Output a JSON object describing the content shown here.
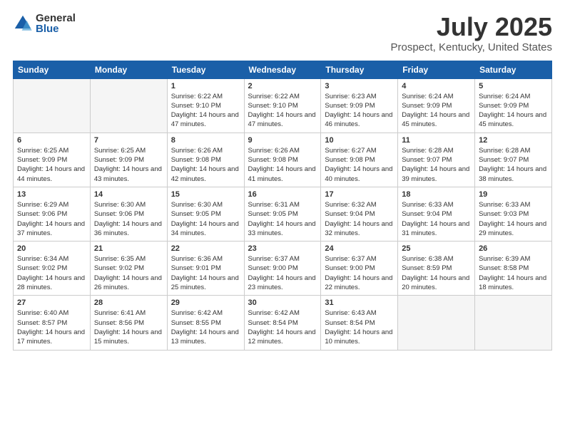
{
  "logo": {
    "general": "General",
    "blue": "Blue"
  },
  "title": {
    "month_year": "July 2025",
    "location": "Prospect, Kentucky, United States"
  },
  "weekdays": [
    "Sunday",
    "Monday",
    "Tuesday",
    "Wednesday",
    "Thursday",
    "Friday",
    "Saturday"
  ],
  "weeks": [
    [
      {
        "day": "",
        "info": ""
      },
      {
        "day": "",
        "info": ""
      },
      {
        "day": "1",
        "info": "Sunrise: 6:22 AM\nSunset: 9:10 PM\nDaylight: 14 hours and 47 minutes."
      },
      {
        "day": "2",
        "info": "Sunrise: 6:22 AM\nSunset: 9:10 PM\nDaylight: 14 hours and 47 minutes."
      },
      {
        "day": "3",
        "info": "Sunrise: 6:23 AM\nSunset: 9:09 PM\nDaylight: 14 hours and 46 minutes."
      },
      {
        "day": "4",
        "info": "Sunrise: 6:24 AM\nSunset: 9:09 PM\nDaylight: 14 hours and 45 minutes."
      },
      {
        "day": "5",
        "info": "Sunrise: 6:24 AM\nSunset: 9:09 PM\nDaylight: 14 hours and 45 minutes."
      }
    ],
    [
      {
        "day": "6",
        "info": "Sunrise: 6:25 AM\nSunset: 9:09 PM\nDaylight: 14 hours and 44 minutes."
      },
      {
        "day": "7",
        "info": "Sunrise: 6:25 AM\nSunset: 9:09 PM\nDaylight: 14 hours and 43 minutes."
      },
      {
        "day": "8",
        "info": "Sunrise: 6:26 AM\nSunset: 9:08 PM\nDaylight: 14 hours and 42 minutes."
      },
      {
        "day": "9",
        "info": "Sunrise: 6:26 AM\nSunset: 9:08 PM\nDaylight: 14 hours and 41 minutes."
      },
      {
        "day": "10",
        "info": "Sunrise: 6:27 AM\nSunset: 9:08 PM\nDaylight: 14 hours and 40 minutes."
      },
      {
        "day": "11",
        "info": "Sunrise: 6:28 AM\nSunset: 9:07 PM\nDaylight: 14 hours and 39 minutes."
      },
      {
        "day": "12",
        "info": "Sunrise: 6:28 AM\nSunset: 9:07 PM\nDaylight: 14 hours and 38 minutes."
      }
    ],
    [
      {
        "day": "13",
        "info": "Sunrise: 6:29 AM\nSunset: 9:06 PM\nDaylight: 14 hours and 37 minutes."
      },
      {
        "day": "14",
        "info": "Sunrise: 6:30 AM\nSunset: 9:06 PM\nDaylight: 14 hours and 36 minutes."
      },
      {
        "day": "15",
        "info": "Sunrise: 6:30 AM\nSunset: 9:05 PM\nDaylight: 14 hours and 34 minutes."
      },
      {
        "day": "16",
        "info": "Sunrise: 6:31 AM\nSunset: 9:05 PM\nDaylight: 14 hours and 33 minutes."
      },
      {
        "day": "17",
        "info": "Sunrise: 6:32 AM\nSunset: 9:04 PM\nDaylight: 14 hours and 32 minutes."
      },
      {
        "day": "18",
        "info": "Sunrise: 6:33 AM\nSunset: 9:04 PM\nDaylight: 14 hours and 31 minutes."
      },
      {
        "day": "19",
        "info": "Sunrise: 6:33 AM\nSunset: 9:03 PM\nDaylight: 14 hours and 29 minutes."
      }
    ],
    [
      {
        "day": "20",
        "info": "Sunrise: 6:34 AM\nSunset: 9:02 PM\nDaylight: 14 hours and 28 minutes."
      },
      {
        "day": "21",
        "info": "Sunrise: 6:35 AM\nSunset: 9:02 PM\nDaylight: 14 hours and 26 minutes."
      },
      {
        "day": "22",
        "info": "Sunrise: 6:36 AM\nSunset: 9:01 PM\nDaylight: 14 hours and 25 minutes."
      },
      {
        "day": "23",
        "info": "Sunrise: 6:37 AM\nSunset: 9:00 PM\nDaylight: 14 hours and 23 minutes."
      },
      {
        "day": "24",
        "info": "Sunrise: 6:37 AM\nSunset: 9:00 PM\nDaylight: 14 hours and 22 minutes."
      },
      {
        "day": "25",
        "info": "Sunrise: 6:38 AM\nSunset: 8:59 PM\nDaylight: 14 hours and 20 minutes."
      },
      {
        "day": "26",
        "info": "Sunrise: 6:39 AM\nSunset: 8:58 PM\nDaylight: 14 hours and 18 minutes."
      }
    ],
    [
      {
        "day": "27",
        "info": "Sunrise: 6:40 AM\nSunset: 8:57 PM\nDaylight: 14 hours and 17 minutes."
      },
      {
        "day": "28",
        "info": "Sunrise: 6:41 AM\nSunset: 8:56 PM\nDaylight: 14 hours and 15 minutes."
      },
      {
        "day": "29",
        "info": "Sunrise: 6:42 AM\nSunset: 8:55 PM\nDaylight: 14 hours and 13 minutes."
      },
      {
        "day": "30",
        "info": "Sunrise: 6:42 AM\nSunset: 8:54 PM\nDaylight: 14 hours and 12 minutes."
      },
      {
        "day": "31",
        "info": "Sunrise: 6:43 AM\nSunset: 8:54 PM\nDaylight: 14 hours and 10 minutes."
      },
      {
        "day": "",
        "info": ""
      },
      {
        "day": "",
        "info": ""
      }
    ]
  ]
}
